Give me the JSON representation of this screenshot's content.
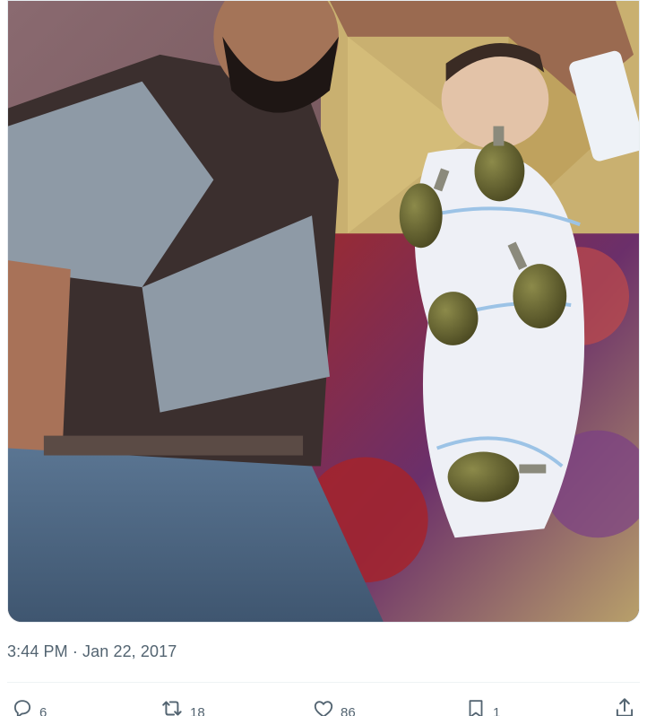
{
  "tweet": {
    "timestamp": "3:44 PM · Jan 22, 2017"
  },
  "actions": {
    "replies": "6",
    "retweets": "18",
    "likes": "86",
    "bookmarks": "1"
  },
  "icons": {
    "reply": "reply-icon",
    "retweet": "retweet-icon",
    "like": "heart-icon",
    "bookmark": "bookmark-icon",
    "share": "share-icon"
  },
  "colors": {
    "muted_text": "#536471",
    "divider": "#eff3f4"
  }
}
